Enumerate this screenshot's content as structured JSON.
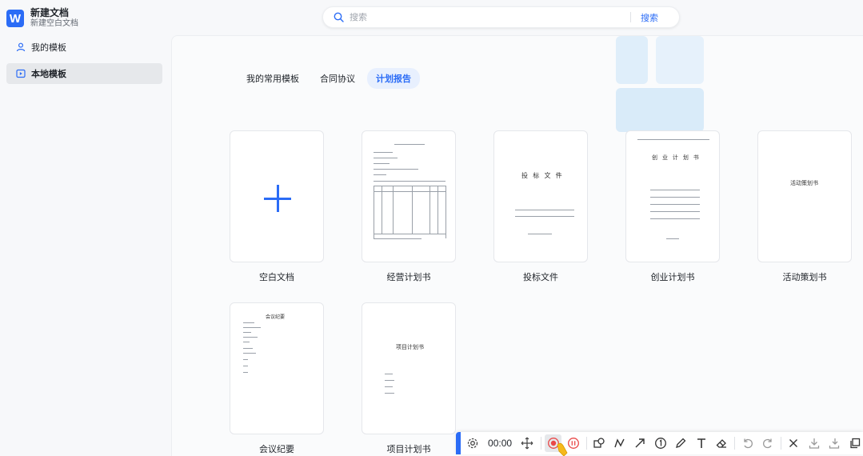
{
  "app": {
    "logo_letter": "W",
    "title": "新建文档",
    "subtitle": "新建空白文档"
  },
  "sidebar": {
    "items": [
      {
        "label": "我的模板",
        "icon": "user-icon"
      },
      {
        "label": "本地模板",
        "icon": "play-folder-icon"
      }
    ]
  },
  "search": {
    "placeholder": "搜索",
    "button_label": "搜索"
  },
  "tabs": [
    {
      "label": "我的常用模板"
    },
    {
      "label": "合同协议"
    },
    {
      "label": "计划报告"
    }
  ],
  "cards": [
    {
      "label": "空白文档"
    },
    {
      "label": "经营计划书"
    },
    {
      "label": "投标文件"
    },
    {
      "label": "创业计划书"
    },
    {
      "label": "活动策划书"
    },
    {
      "label": "会议纪要"
    },
    {
      "label": "项目计划书"
    }
  ],
  "thumbs": {
    "bid_title": "投 标 文 件",
    "startup_title": "创 业 计 划 书",
    "event_title": "活动策划书",
    "project_title": "项目计划书",
    "meeting_title": "会议纪要"
  },
  "toolbar": {
    "time": "00:00"
  },
  "colors": {
    "accent": "#2b6cf6",
    "record": "#e94848"
  }
}
